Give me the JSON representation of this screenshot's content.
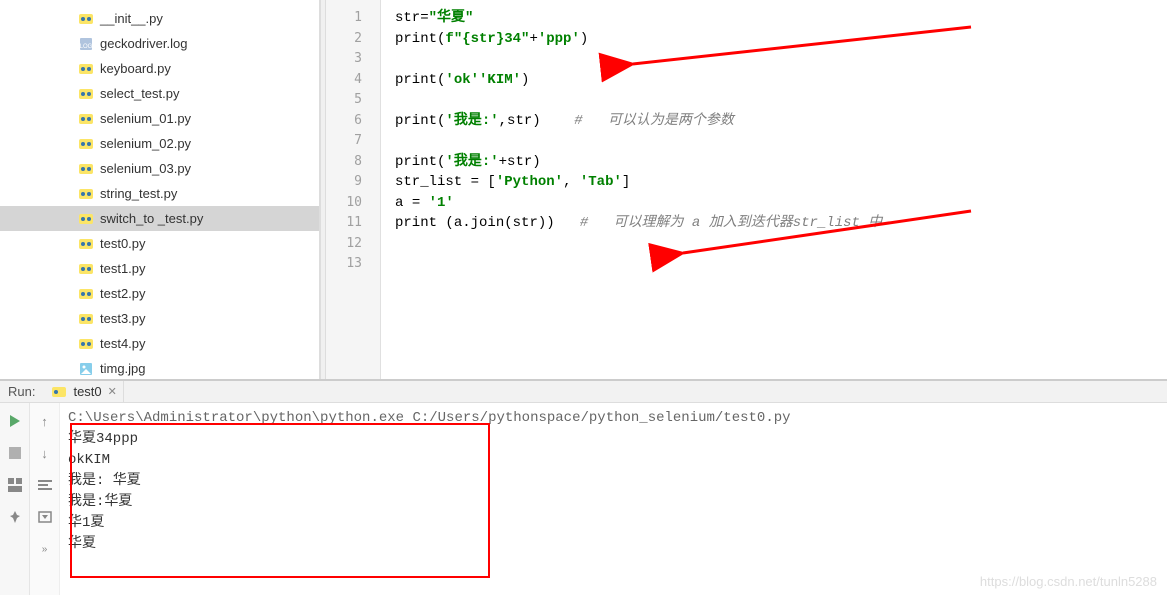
{
  "file_tree": {
    "items": [
      {
        "name": "__init__.py",
        "type": "py",
        "selected": false
      },
      {
        "name": "geckodriver.log",
        "type": "log",
        "selected": false
      },
      {
        "name": "keyboard.py",
        "type": "py",
        "selected": false
      },
      {
        "name": "select_test.py",
        "type": "py",
        "selected": false
      },
      {
        "name": "selenium_01.py",
        "type": "py",
        "selected": false
      },
      {
        "name": "selenium_02.py",
        "type": "py",
        "selected": false
      },
      {
        "name": "selenium_03.py",
        "type": "py",
        "selected": false
      },
      {
        "name": "string_test.py",
        "type": "py",
        "selected": false
      },
      {
        "name": "switch_to _test.py",
        "type": "py",
        "selected": true
      },
      {
        "name": "test0.py",
        "type": "py",
        "selected": false
      },
      {
        "name": "test1.py",
        "type": "py",
        "selected": false
      },
      {
        "name": "test2.py",
        "type": "py",
        "selected": false
      },
      {
        "name": "test3.py",
        "type": "py",
        "selected": false
      },
      {
        "name": "test4.py",
        "type": "py",
        "selected": false
      },
      {
        "name": "timg.jpg",
        "type": "img",
        "selected": false
      }
    ]
  },
  "editor": {
    "line_numbers": [
      "1",
      "2",
      "3",
      "4",
      "5",
      "6",
      "7",
      "8",
      "9",
      "10",
      "11",
      "12",
      "13"
    ],
    "code_lines": [
      {
        "tokens": [
          {
            "t": "id",
            "v": "str"
          },
          {
            "t": "op",
            "v": "="
          },
          {
            "t": "str",
            "v": "\"华夏\""
          }
        ]
      },
      {
        "tokens": [
          {
            "t": "func",
            "v": "print"
          },
          {
            "t": "op",
            "v": "("
          },
          {
            "t": "fstr",
            "v": "f\"{str}34\""
          },
          {
            "t": "op",
            "v": "+"
          },
          {
            "t": "str",
            "v": "'ppp'"
          },
          {
            "t": "op",
            "v": ")"
          }
        ]
      },
      {
        "tokens": []
      },
      {
        "tokens": [
          {
            "t": "func",
            "v": "print"
          },
          {
            "t": "op",
            "v": "("
          },
          {
            "t": "str",
            "v": "'ok''KIM'"
          },
          {
            "t": "op",
            "v": ")"
          }
        ]
      },
      {
        "tokens": []
      },
      {
        "tokens": [
          {
            "t": "func",
            "v": "print"
          },
          {
            "t": "op",
            "v": "("
          },
          {
            "t": "str",
            "v": "'我是:'"
          },
          {
            "t": "op",
            "v": ","
          },
          {
            "t": "id",
            "v": "str"
          },
          {
            "t": "op",
            "v": ")    "
          },
          {
            "t": "comment",
            "v": "#   可以认为是两个参数"
          }
        ]
      },
      {
        "tokens": []
      },
      {
        "tokens": [
          {
            "t": "func",
            "v": "print"
          },
          {
            "t": "op",
            "v": "("
          },
          {
            "t": "str",
            "v": "'我是:'"
          },
          {
            "t": "op",
            "v": "+"
          },
          {
            "t": "id",
            "v": "str"
          },
          {
            "t": "op",
            "v": ")"
          }
        ]
      },
      {
        "tokens": [
          {
            "t": "id",
            "v": "str_list "
          },
          {
            "t": "op",
            "v": "= ["
          },
          {
            "t": "str",
            "v": "'Python'"
          },
          {
            "t": "op",
            "v": ", "
          },
          {
            "t": "str",
            "v": "'Tab'"
          },
          {
            "t": "op",
            "v": "]"
          }
        ]
      },
      {
        "tokens": [
          {
            "t": "id",
            "v": "a "
          },
          {
            "t": "op",
            "v": "= "
          },
          {
            "t": "str",
            "v": "'1'"
          }
        ]
      },
      {
        "tokens": [
          {
            "t": "func",
            "v": "print "
          },
          {
            "t": "op",
            "v": "("
          },
          {
            "t": "id",
            "v": "a.join"
          },
          {
            "t": "op",
            "v": "("
          },
          {
            "t": "id",
            "v": "str"
          },
          {
            "t": "op",
            "v": "))   "
          },
          {
            "t": "comment",
            "v": "#   可以理解为 a 加入到迭代器str_list 中"
          }
        ]
      },
      {
        "tokens": []
      },
      {
        "tokens": []
      }
    ]
  },
  "run_panel": {
    "label": "Run:",
    "tab_name": "test0",
    "console_lines": [
      "C:\\Users\\Administrator\\python\\python.exe C:/Users/pythonspace/python_selenium/test0.py",
      "华夏34ppp",
      "okKIM",
      "我是: 华夏",
      "我是:华夏",
      "华1夏",
      "华夏"
    ]
  },
  "watermark": "https://blog.csdn.net/tunln5288"
}
